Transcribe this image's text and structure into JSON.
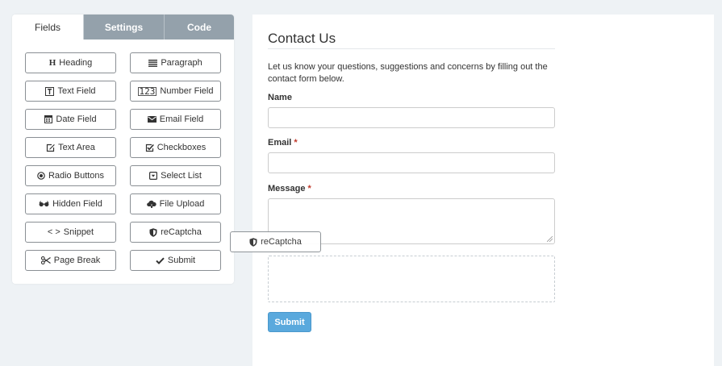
{
  "tabs": [
    {
      "label": "Fields"
    },
    {
      "label": "Settings"
    },
    {
      "label": "Code"
    }
  ],
  "fields": [
    {
      "label": "Heading",
      "icon": "heading-icon"
    },
    {
      "label": "Paragraph",
      "icon": "paragraph-icon"
    },
    {
      "label": "Text Field",
      "icon": "text-field-icon"
    },
    {
      "label": "Number Field",
      "icon": "number-icon",
      "icon_text": "123"
    },
    {
      "label": "Date Field",
      "icon": "calendar-icon"
    },
    {
      "label": "Email Field",
      "icon": "envelope-icon"
    },
    {
      "label": "Text Area",
      "icon": "edit-icon"
    },
    {
      "label": "Checkboxes",
      "icon": "checkbox-icon"
    },
    {
      "label": "Radio Buttons",
      "icon": "radio-icon"
    },
    {
      "label": "Select List",
      "icon": "select-icon"
    },
    {
      "label": "Hidden Field",
      "icon": "eyeglasses-icon"
    },
    {
      "label": "File Upload",
      "icon": "cloud-upload-icon"
    },
    {
      "label": "Snippet",
      "icon": "code-icon",
      "icon_text": "< >"
    },
    {
      "label": "reCaptcha",
      "icon": "shield-icon"
    },
    {
      "label": "Page Break",
      "icon": "scissors-icon"
    },
    {
      "label": "Submit",
      "icon": "checkmark-icon"
    }
  ],
  "drag_ghost": {
    "label": "reCaptcha",
    "icon": "shield-icon"
  },
  "form": {
    "title": "Contact Us",
    "description": "Let us know your questions, suggestions and concerns by filling out the contact form below.",
    "name_label": "Name",
    "email_label": "Email",
    "message_label": "Message",
    "required_mark": "*",
    "submit_label": "Submit"
  },
  "colors": {
    "page_bg": "#eef2f5",
    "tab_inactive": "#94a1ab",
    "submit": "#5aa9dd",
    "required": "#c0392b"
  }
}
